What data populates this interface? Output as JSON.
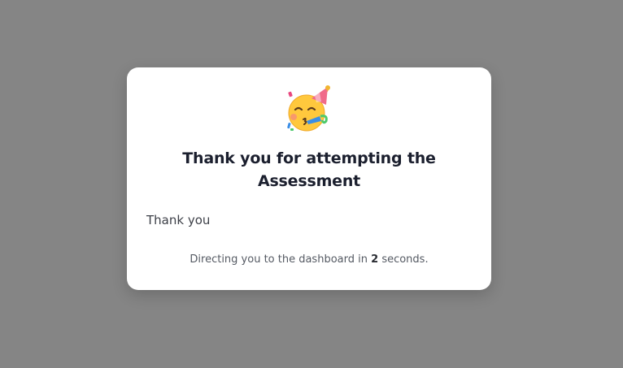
{
  "modal": {
    "icon": "party-face-icon",
    "title": "Thank you for attempting the Assessment",
    "message": "Thank you",
    "redirect_prefix": "Directing you to the dashboard in",
    "redirect_seconds": "2",
    "redirect_suffix": "seconds."
  },
  "colors": {
    "overlay": "#858585",
    "card": "#ffffff",
    "title": "#1b1f2e",
    "emoji_face": "#ffc83d"
  }
}
